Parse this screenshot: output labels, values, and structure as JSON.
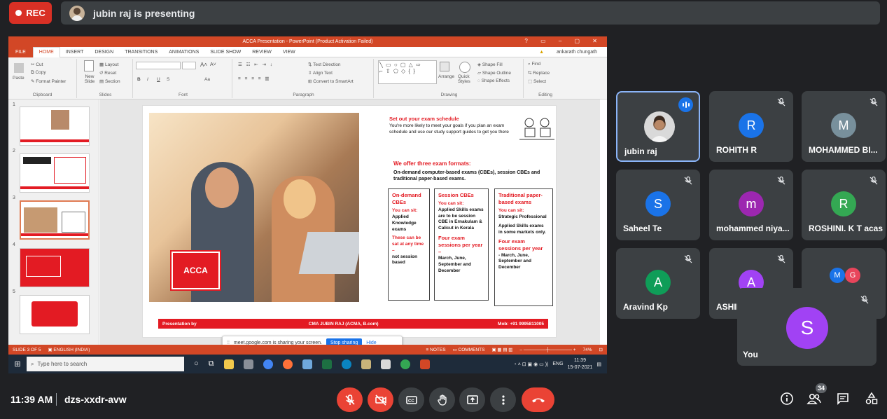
{
  "topbar": {
    "rec_label": "REC",
    "presenting_text": "jubin raj is presenting"
  },
  "powerpoint": {
    "title": "ACCA Presentation - PowerPoint (Product Activation Failed)",
    "tabs": [
      "FILE",
      "HOME",
      "INSERT",
      "DESIGN",
      "TRANSITIONS",
      "ANIMATIONS",
      "SLIDE SHOW",
      "REVIEW",
      "VIEW"
    ],
    "user": "ankarath chungath",
    "ribbon": {
      "clipboard": {
        "label": "Clipboard",
        "paste": "Paste",
        "cut": "Cut",
        "copy": "Copy",
        "format_painter": "Format Painter"
      },
      "slides": {
        "label": "Slides",
        "new_slide": "New Slide",
        "layout": "Layout",
        "reset": "Reset",
        "section": "Section"
      },
      "font": {
        "label": "Font",
        "bold": "B",
        "italic": "I",
        "underline": "U",
        "strike": "S",
        "aa": "Aa",
        "a_up": "A",
        "a_down": "A"
      },
      "paragraph": {
        "label": "Paragraph",
        "text_direction": "Text Direction",
        "align_text": "Align Text",
        "convert_smartart": "Convert to SmartArt"
      },
      "drawing": {
        "label": "Drawing",
        "arrange": "Arrange",
        "quick_styles": "Quick Styles",
        "shape_fill": "Shape Fill",
        "shape_outline": "Shape Outline",
        "shape_effects": "Shape Effects"
      },
      "editing": {
        "label": "Editing",
        "find": "Find",
        "replace": "Replace",
        "select": "Select"
      }
    },
    "thumbnails": [
      "1",
      "2",
      "3",
      "4",
      "5"
    ],
    "slide": {
      "logo": "ACCA",
      "heading1": "Set out your exam schedule",
      "text1": "You're more likely to meet your goals if you plan an exam schedule and use our study support guides to get you there",
      "heading2": "We offer three exam formats:",
      "text2": "On-demand computer-based exams (CBEs), session CBEs and traditional paper-based exams.",
      "boxes": [
        {
          "title": "On-demand CBEs",
          "sit": "You can sit:",
          "desc": "Applied Knowledge exams",
          "extra_red": "These can be sat at any time –",
          "extra": "not session based"
        },
        {
          "title": "Session CBEs",
          "sit": "You can sit:",
          "desc": "Applied Skills exams are to be session CBE in Ernakulam & Calicut in Kerala",
          "extra_red": "Four exam sessions per year –",
          "extra": "March, June, September and December"
        },
        {
          "title": "Traditional paper-based exams",
          "sit": "You can sit:",
          "desc": "Strategic Professional",
          "desc2": "Applied Skills exams in some markets only.",
          "extra_red": "Four exam sessions per year",
          "extra": "- March, June, September and December"
        }
      ],
      "footer_left": "Presentation by",
      "footer_mid": "CMA JUBIN RAJ (ACMA, B.com)",
      "footer_right": "Mob: +91 9995811005"
    },
    "share_popup": {
      "text": "meet.google.com is sharing your screen.",
      "stop": "Stop sharing",
      "hide": "Hide"
    },
    "statusbar": {
      "slide": "SLIDE 3 OF 5",
      "lang": "ENGLISH (INDIA)",
      "notes": "NOTES",
      "comments": "COMMENTS",
      "zoom": "74%"
    }
  },
  "taskbar": {
    "search_placeholder": "Type here to search",
    "lang": "ENG",
    "time": "11:39",
    "date": "15-07-2021"
  },
  "participants": [
    {
      "name": "jubin raj",
      "initial": "",
      "color": "#d9d9d9",
      "speaking": true
    },
    {
      "name": "ROHITH R",
      "initial": "R",
      "color": "#1a73e8"
    },
    {
      "name": "MOHAMMED BI...",
      "initial": "M",
      "color": "#78909c"
    },
    {
      "name": "Saheel Te",
      "initial": "S",
      "color": "#1a73e8"
    },
    {
      "name": "mohammed niya...",
      "initial": "m",
      "color": "#9c27b0"
    },
    {
      "name": "ROSHINI. K T acas",
      "initial": "R",
      "color": "#34a853"
    },
    {
      "name": "Aravind Kp",
      "initial": "A",
      "color": "#0f9d58"
    },
    {
      "name": "ASHID",
      "initial": "A",
      "color": "#a142f4"
    },
    {
      "name": "",
      "initial": "M",
      "initial2": "G",
      "color": "#1a73e8",
      "color2": "#e8455b"
    }
  ],
  "you_tile": {
    "name": "You",
    "initial": "S"
  },
  "bottombar": {
    "time": "11:39 AM",
    "meeting_code": "dzs-xxdr-avw",
    "participant_count": "34"
  },
  "colors": {
    "end_call": "#ea4335",
    "accent": "#8ab4f8",
    "ppt": "#d24726",
    "acca": "#e31b23"
  }
}
